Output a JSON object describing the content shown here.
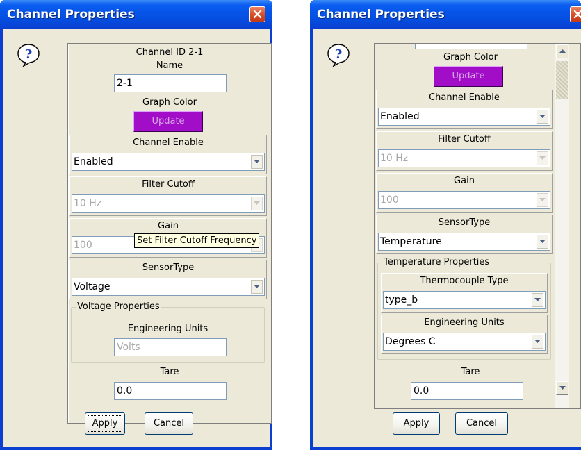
{
  "colors": {
    "title_bar": "#0450e2",
    "graph_color": "#a20ec8",
    "window_face": "#ece9d8"
  },
  "icons": {
    "help": "help-question-icon",
    "close": "close-x-icon",
    "dropdown": "chevron-down-icon"
  },
  "left": {
    "title": "Channel Properties",
    "channel_id": "Channel ID 2-1",
    "name_label": "Name",
    "name_value": "2-1",
    "graph_color_label": "Graph Color",
    "update_label": "Update",
    "channel_enable_label": "Channel Enable",
    "channel_enable_value": "Enabled",
    "filter_cutoff_label": "Filter Cutoff",
    "filter_cutoff_value": "10 Hz",
    "gain_label": "Gain",
    "gain_value": "100",
    "tooltip": "Set Filter Cutoff Frequency",
    "sensor_type_label": "SensorType",
    "sensor_type_value": "Voltage",
    "props_label": "Voltage Properties",
    "eng_units_label": "Engineering Units",
    "eng_units_value": "Volts",
    "tare_label": "Tare",
    "tare_value": "0.0",
    "apply_label": "Apply",
    "cancel_label": "Cancel"
  },
  "right": {
    "title": "Channel Properties",
    "graph_color_label": "Graph Color",
    "update_label": "Update",
    "channel_enable_label": "Channel Enable",
    "channel_enable_value": "Enabled",
    "filter_cutoff_label": "Filter Cutoff",
    "filter_cutoff_value": "10 Hz",
    "gain_label": "Gain",
    "gain_value": "100",
    "sensor_type_label": "SensorType",
    "sensor_type_value": "Temperature",
    "props_label": "Temperature Properties",
    "thermocouple_label": "Thermocouple Type",
    "thermocouple_value": "type_b",
    "eng_units_label": "Engineering Units",
    "eng_units_value": "Degrees C",
    "tare_label": "Tare",
    "tare_value": "0.0",
    "apply_label": "Apply",
    "cancel_label": "Cancel"
  }
}
